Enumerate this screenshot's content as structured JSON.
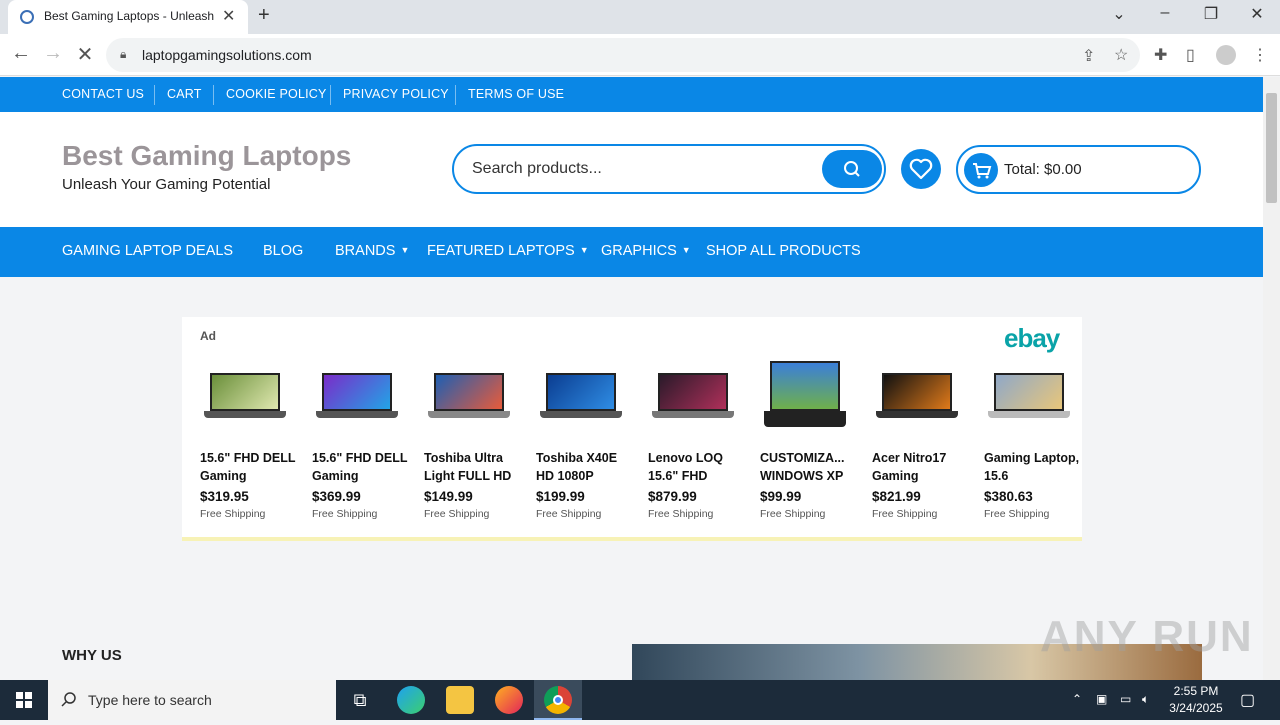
{
  "browser": {
    "tab_title": "Best Gaming Laptops - Unleash Your Gaming Potential",
    "url": "laptopgamingsolutions.com"
  },
  "topnav": [
    "CONTACT US",
    "CART",
    "COOKIE POLICY",
    "PRIVACY POLICY",
    "TERMS OF USE"
  ],
  "header": {
    "brand": "Best Gaming Laptops",
    "tagline": "Unleash Your Gaming Potential",
    "search_placeholder": "Search products...",
    "cart_total": "Total: $0.00"
  },
  "mainnav": [
    {
      "label": "GAMING LAPTOP DEALS",
      "dropdown": false
    },
    {
      "label": "BLOG",
      "dropdown": false
    },
    {
      "label": "BRANDS",
      "dropdown": true
    },
    {
      "label": "FEATURED LAPTOPS",
      "dropdown": true
    },
    {
      "label": "GRAPHICS",
      "dropdown": true
    },
    {
      "label": "SHOP ALL PRODUCTS",
      "dropdown": false
    }
  ],
  "ad": {
    "label": "Ad",
    "brand": "ebay",
    "products": [
      {
        "name": "15.6\" FHD DELL Gaming",
        "price": "$319.95",
        "shipping": "Free Shipping"
      },
      {
        "name": "15.6\" FHD DELL Gaming",
        "price": "$369.99",
        "shipping": "Free Shipping"
      },
      {
        "name": "Toshiba Ultra Light FULL HD",
        "price": "$149.99",
        "shipping": "Free Shipping"
      },
      {
        "name": "Toshiba X40E HD 1080P",
        "price": "$199.99",
        "shipping": "Free Shipping"
      },
      {
        "name": "Lenovo LOQ 15.6\" FHD",
        "price": "$879.99",
        "shipping": "Free Shipping"
      },
      {
        "name": "CUSTOMIZA... WINDOWS XP",
        "price": "$99.99",
        "shipping": "Free Shipping"
      },
      {
        "name": "Acer Nitro17 Gaming",
        "price": "$821.99",
        "shipping": "Free Shipping"
      },
      {
        "name": "Gaming Laptop, 15.6",
        "price": "$380.63",
        "shipping": "Free Shipping"
      }
    ]
  },
  "section": {
    "why_us": "WHY US"
  },
  "watermark": "ANY RUN",
  "taskbar": {
    "search_placeholder": "Type here to search",
    "time": "2:55 PM",
    "date": "3/24/2025"
  },
  "colors": {
    "accent": "#0a87e6",
    "brand_gray": "#9b9599",
    "ebay_teal": "#0aa3a8"
  }
}
